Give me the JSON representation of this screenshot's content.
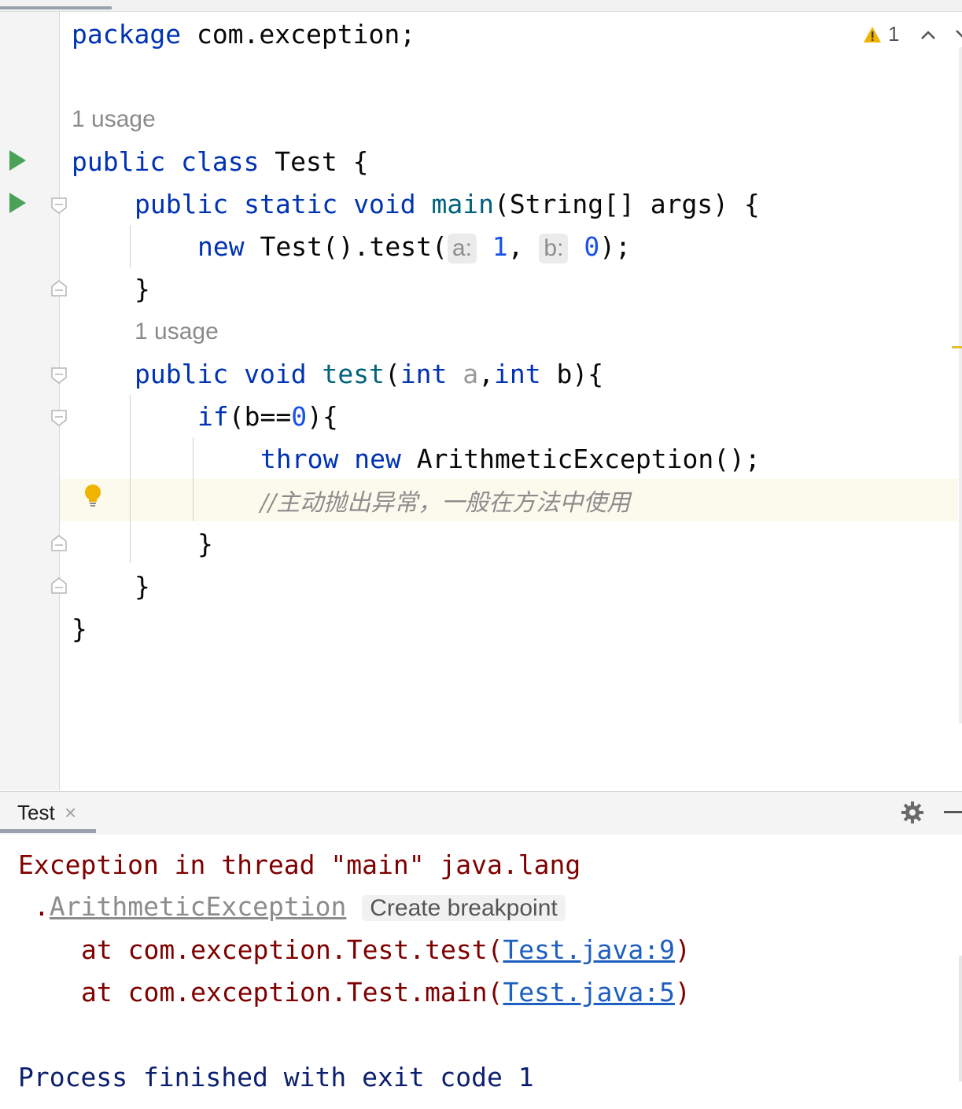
{
  "editor": {
    "package_kw": "package",
    "package_name": " com.exception;",
    "usage_class": "1 usage",
    "usage_method": "1 usage",
    "class_public": "public",
    "class_kw": "class",
    "class_name": " Test {",
    "main_public": "public",
    "main_static": "static",
    "main_void": "void",
    "main_name": "main",
    "main_sig": "(String[] args) {",
    "call_new": "new",
    "call_expr": " Test().test(",
    "hint_a": "a:",
    "arg_a": "1",
    "comma": ", ",
    "hint_b": "b:",
    "arg_b": "0",
    "call_end": ");",
    "close_brace": "}",
    "test_public": "public",
    "test_void": "void",
    "test_name": "test",
    "test_open": "(",
    "int1": "int",
    "param_a": "a",
    "comma2": ",",
    "int2": "int",
    "test_sig_end": " b){",
    "if_kw": "if",
    "if_cond_start": "(b==",
    "if_zero": "0",
    "if_cond_end": "){",
    "throw_kw": "throw",
    "throw_new": "new",
    "throw_expr": " ArithmeticException();",
    "comment": "//主动抛出异常，一般在方法中使用",
    "warning_count": "1"
  },
  "run_panel": {
    "tab_label": "Test",
    "close_symbol": "×"
  },
  "console": {
    "exception_line": "Exception in thread \"main\" java.lang",
    "exception_dot": ".",
    "exception_class": "ArithmeticException",
    "create_breakpoint": "Create breakpoint",
    "stack1_prefix": "at com.exception.Test.test(",
    "stack1_link": "Test.java:9",
    "stack1_suffix": ")",
    "stack2_prefix": "at com.exception.Test.main(",
    "stack2_link": "Test.java:5",
    "stack2_suffix": ")",
    "process_line": "Process finished with exit code 1"
  },
  "icons": [
    "run-icon",
    "fold-icon",
    "bulb-icon",
    "warning-icon",
    "chevron-up-icon",
    "chevron-down-icon",
    "gear-icon",
    "minimize-icon"
  ],
  "colors": {
    "keyword": "#0033b3",
    "function": "#00627a",
    "number": "#1750eb",
    "error": "#7f0000",
    "link": "#1f5fbf",
    "run": "#4aa256"
  }
}
